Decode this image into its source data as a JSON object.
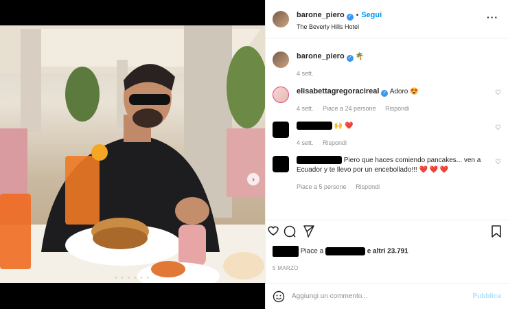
{
  "post": {
    "username": "barone_piero",
    "follow_label": "Segui",
    "location": "The Beverly Hills Hotel",
    "caption_emoji": "🌴",
    "caption_time": "4 sett."
  },
  "comments": [
    {
      "username": "elisabettagregoracireal",
      "text": "Adoro 😍",
      "time": "4 sett.",
      "likes": "Piace a 24 persone",
      "reply": "Rispondi"
    },
    {
      "username": "",
      "text": "🙌 ❤️",
      "time": "4 sett.",
      "reply": "Rispondi"
    },
    {
      "username": "",
      "text": "Piero que haces comiendo pancakes... ven a Ecuador y te llevo por un encebollado!!! ❤️ ❤️ ❤️",
      "time": "",
      "likes": "Piace a 5 persone",
      "reply": "Rispondi"
    }
  ],
  "likes": {
    "prefix": "Piace a",
    "suffix": "e altri 23.791"
  },
  "date": "5 MARZO",
  "add_comment": {
    "placeholder": "Aggiungi un commento...",
    "publish": "Pubblica"
  },
  "icons": [
    "heart-icon",
    "comment-icon",
    "share-icon",
    "bookmark-icon",
    "more-icon",
    "emoji-icon"
  ],
  "colors": {
    "accent": "#0095f6",
    "verified": "#3897f0",
    "publish_disabled": "#b2dffc"
  }
}
